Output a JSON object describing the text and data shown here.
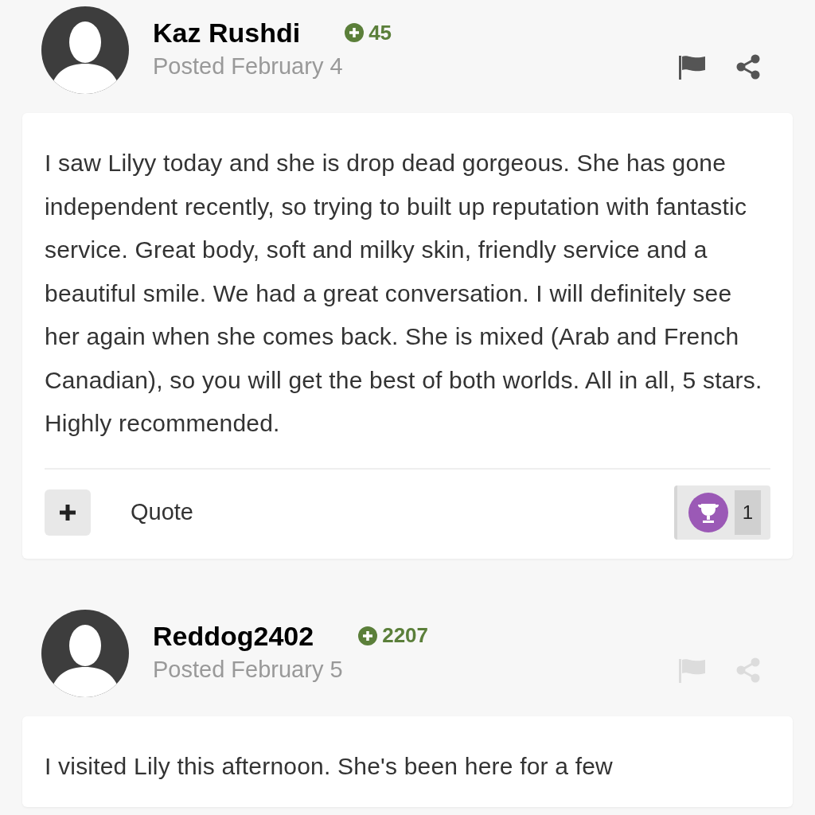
{
  "posts": [
    {
      "author": "Kaz Rushdi",
      "reputation": "45",
      "date": "Posted February 4",
      "icons_faded": false,
      "body": "I saw Lilyy today and she is drop dead gorgeous. She has gone independent recently, so trying to built up reputation with fantastic service. Great body, soft and milky skin, friendly service and a beautiful smile. We had a great conversation. I will definitely see her again when she comes back. She is mixed (Arab and French Canadian), so you will get the best of both worlds. All in all, 5 stars. Highly recommended.",
      "footer": {
        "quote": "Quote",
        "reaction_count": "1"
      }
    },
    {
      "author": "Reddog2402",
      "reputation": "2207",
      "date": "Posted February 5",
      "icons_faded": true,
      "body": "I visited Lily this afternoon.  She's been here for a few"
    }
  ]
}
